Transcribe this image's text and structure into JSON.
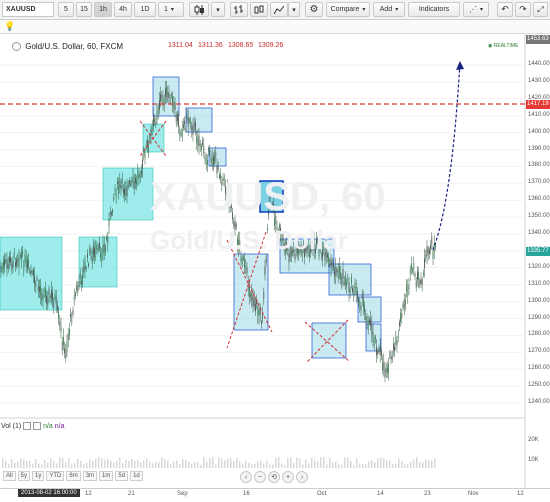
{
  "toolbar": {
    "symbol": "XAUUSD",
    "intervals": [
      "5",
      "15",
      "1h",
      "4h",
      "1D",
      "1"
    ],
    "active_interval": "1h",
    "compare_label": "Compare",
    "add_label": "Add",
    "indicators_label": "Indicators"
  },
  "legend": {
    "title": "Gold/U.S. Dollar, 60, FXCM",
    "open": "1311.04",
    "high": "1311.36",
    "low": "1308.65",
    "close": "1309.26",
    "realtime": "REALTIME"
  },
  "watermark": {
    "line1": "XAUUSD, 60",
    "line2": "Gold/U.S. Dollar"
  },
  "price_axis": {
    "ticks": [
      "1440.00",
      "1430.00",
      "1420.00",
      "1410.00",
      "1400.00",
      "1390.00",
      "1380.00",
      "1370.00",
      "1360.00",
      "1350.00",
      "1340.00",
      "1330.00",
      "1320.00",
      "1310.00",
      "1300.00",
      "1290.00",
      "1280.00",
      "1270.00",
      "1260.00",
      "1250.00",
      "1240.00"
    ],
    "top_value": "1453.63",
    "red_level": "1417.19",
    "current_price": "1335.77"
  },
  "volume": {
    "label": "Vol (1)",
    "value1": "n/a",
    "value2": "n/a",
    "ticks": [
      "20K",
      "10K"
    ]
  },
  "periods": [
    "All",
    "5y",
    "1y",
    "YTD",
    "6m",
    "3m",
    "1m",
    "5d",
    "1d"
  ],
  "time_axis": {
    "cursor_date": "2013-08-02 16:00:00",
    "labels": [
      "12",
      "21",
      "Sep",
      "16",
      "Oct",
      "14",
      "23",
      "Nov",
      "12"
    ]
  },
  "colors": {
    "up_box": "#7fe5e5",
    "down_box": "#9fd8e8",
    "red_line": "#e53935",
    "dashed_blue": "#1a237e"
  }
}
